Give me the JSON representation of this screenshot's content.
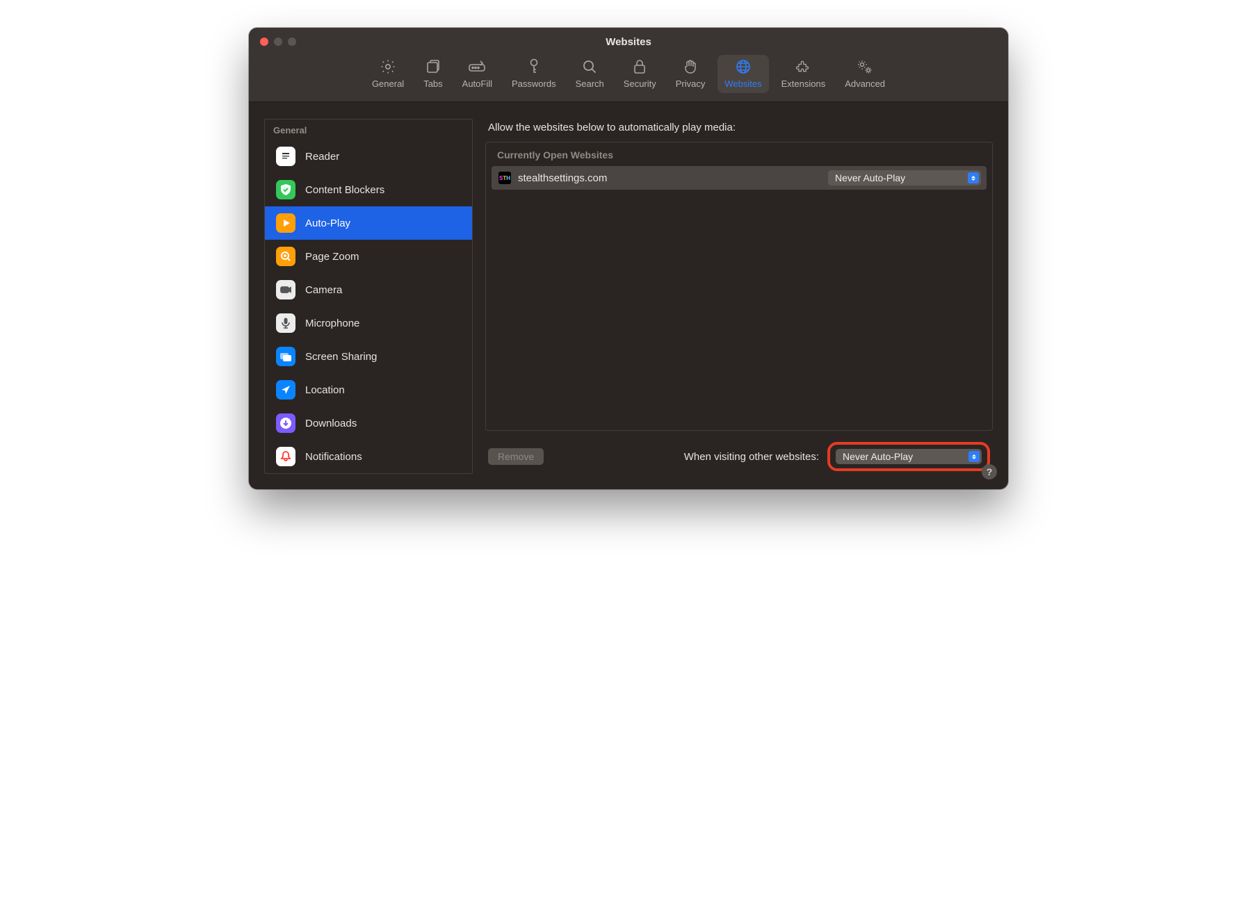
{
  "window": {
    "title": "Websites"
  },
  "toolbar": {
    "general": "General",
    "tabs": "Tabs",
    "autofill": "AutoFill",
    "passwords": "Passwords",
    "search": "Search",
    "security": "Security",
    "privacy": "Privacy",
    "websites": "Websites",
    "extensions": "Extensions",
    "advanced": "Advanced"
  },
  "sidebar": {
    "header": "General",
    "items": [
      {
        "label": "Reader"
      },
      {
        "label": "Content Blockers"
      },
      {
        "label": "Auto-Play"
      },
      {
        "label": "Page Zoom"
      },
      {
        "label": "Camera"
      },
      {
        "label": "Microphone"
      },
      {
        "label": "Screen Sharing"
      },
      {
        "label": "Location"
      },
      {
        "label": "Downloads"
      },
      {
        "label": "Notifications"
      }
    ]
  },
  "main": {
    "description": "Allow the websites below to automatically play media:",
    "list_header": "Currently Open Websites",
    "sites": [
      {
        "domain": "stealthsettings.com",
        "policy": "Never Auto-Play"
      }
    ],
    "remove_label": "Remove",
    "other_label": "When visiting other websites:",
    "other_policy": "Never Auto-Play"
  },
  "help": "?"
}
